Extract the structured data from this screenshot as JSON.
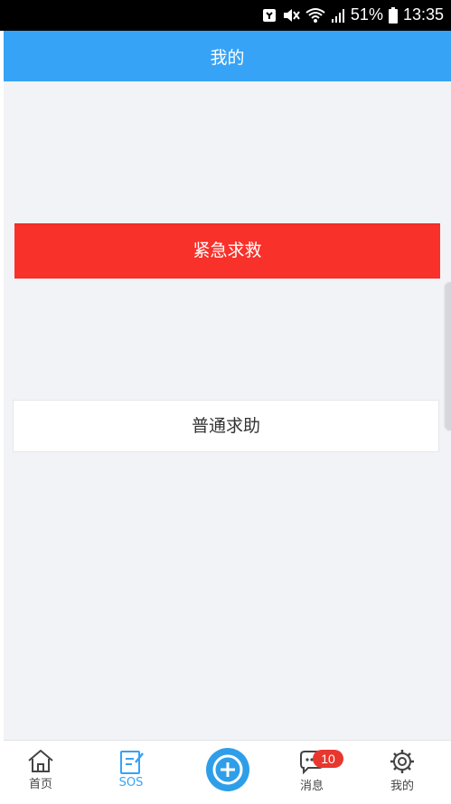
{
  "status_bar": {
    "battery": "51%",
    "time": "13:35"
  },
  "header": {
    "title": "我的"
  },
  "main": {
    "emergency_label": "紧急求救",
    "normal_label": "普通求助"
  },
  "tabbar": {
    "home_label": "首页",
    "sos_label": "SOS",
    "message_label": "消息",
    "message_badge": "10",
    "me_label": "我的"
  },
  "colors": {
    "header": "#36a3f7",
    "emergency": "#f8312a",
    "background": "#f2f3f7",
    "badge": "#e8372e"
  }
}
